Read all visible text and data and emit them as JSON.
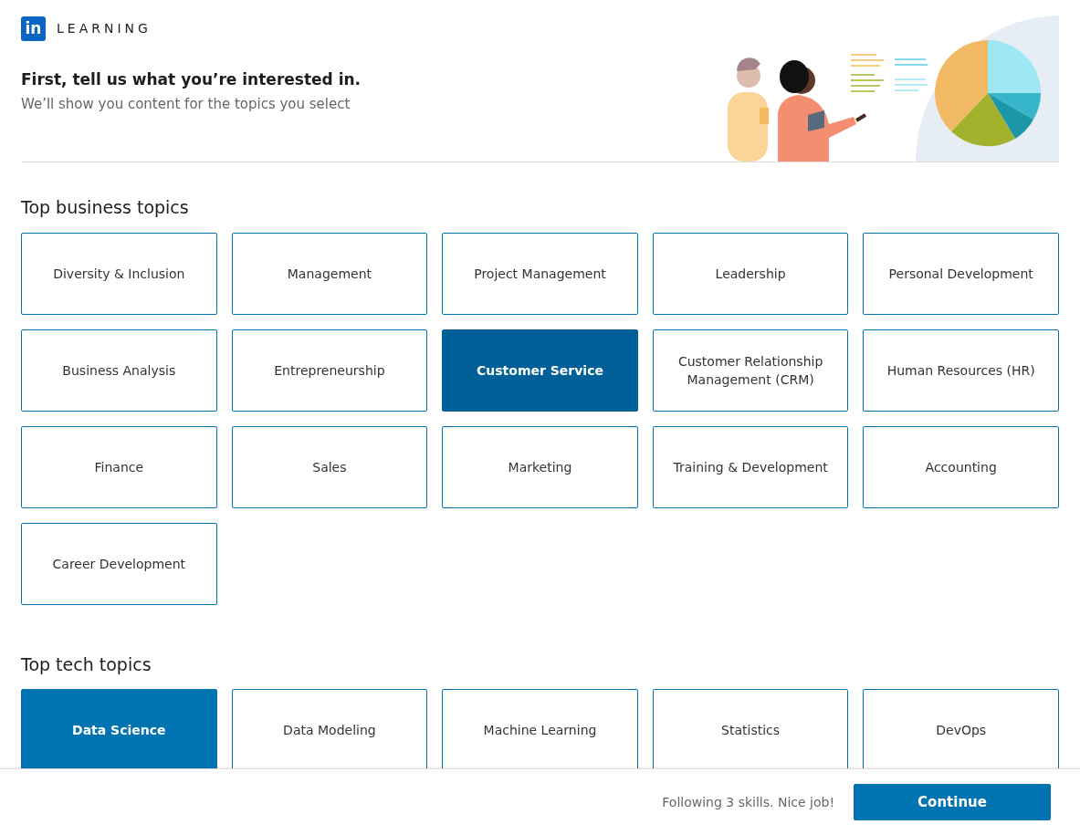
{
  "brand": {
    "logo": "in",
    "name": "LEARNING"
  },
  "header": {
    "title": "First, tell us what you’re interested in.",
    "subtitle": "We’ll show you content for the topics you select"
  },
  "sections": [
    {
      "title": "Top business topics",
      "topics": [
        {
          "label": "Diversity & Inclusion",
          "selected": false,
          "hovered": false
        },
        {
          "label": "Management",
          "selected": false,
          "hovered": false
        },
        {
          "label": "Project Management",
          "selected": false,
          "hovered": false
        },
        {
          "label": "Leadership",
          "selected": false,
          "hovered": false
        },
        {
          "label": "Personal Development",
          "selected": false,
          "hovered": false
        },
        {
          "label": "Business Analysis",
          "selected": false,
          "hovered": false
        },
        {
          "label": "Entrepreneurship",
          "selected": false,
          "hovered": false
        },
        {
          "label": "Customer Service",
          "selected": true,
          "hovered": true
        },
        {
          "label": "Customer Relationship Management (CRM)",
          "selected": false,
          "hovered": false
        },
        {
          "label": "Human Resources (HR)",
          "selected": false,
          "hovered": false
        },
        {
          "label": "Finance",
          "selected": false,
          "hovered": false
        },
        {
          "label": "Sales",
          "selected": false,
          "hovered": false
        },
        {
          "label": "Marketing",
          "selected": false,
          "hovered": false
        },
        {
          "label": "Training & Development",
          "selected": false,
          "hovered": false
        },
        {
          "label": "Accounting",
          "selected": false,
          "hovered": false
        },
        {
          "label": "Career Development",
          "selected": false,
          "hovered": false
        }
      ]
    },
    {
      "title": "Top tech topics",
      "topics": [
        {
          "label": "Data Science",
          "selected": true,
          "hovered": false
        },
        {
          "label": "Data Modeling",
          "selected": false,
          "hovered": false
        },
        {
          "label": "Machine Learning",
          "selected": false,
          "hovered": false
        },
        {
          "label": "Statistics",
          "selected": false,
          "hovered": false
        },
        {
          "label": "DevOps",
          "selected": false,
          "hovered": false
        }
      ]
    }
  ],
  "footer": {
    "status": "Following 3 skills. Nice job!",
    "button": "Continue"
  }
}
